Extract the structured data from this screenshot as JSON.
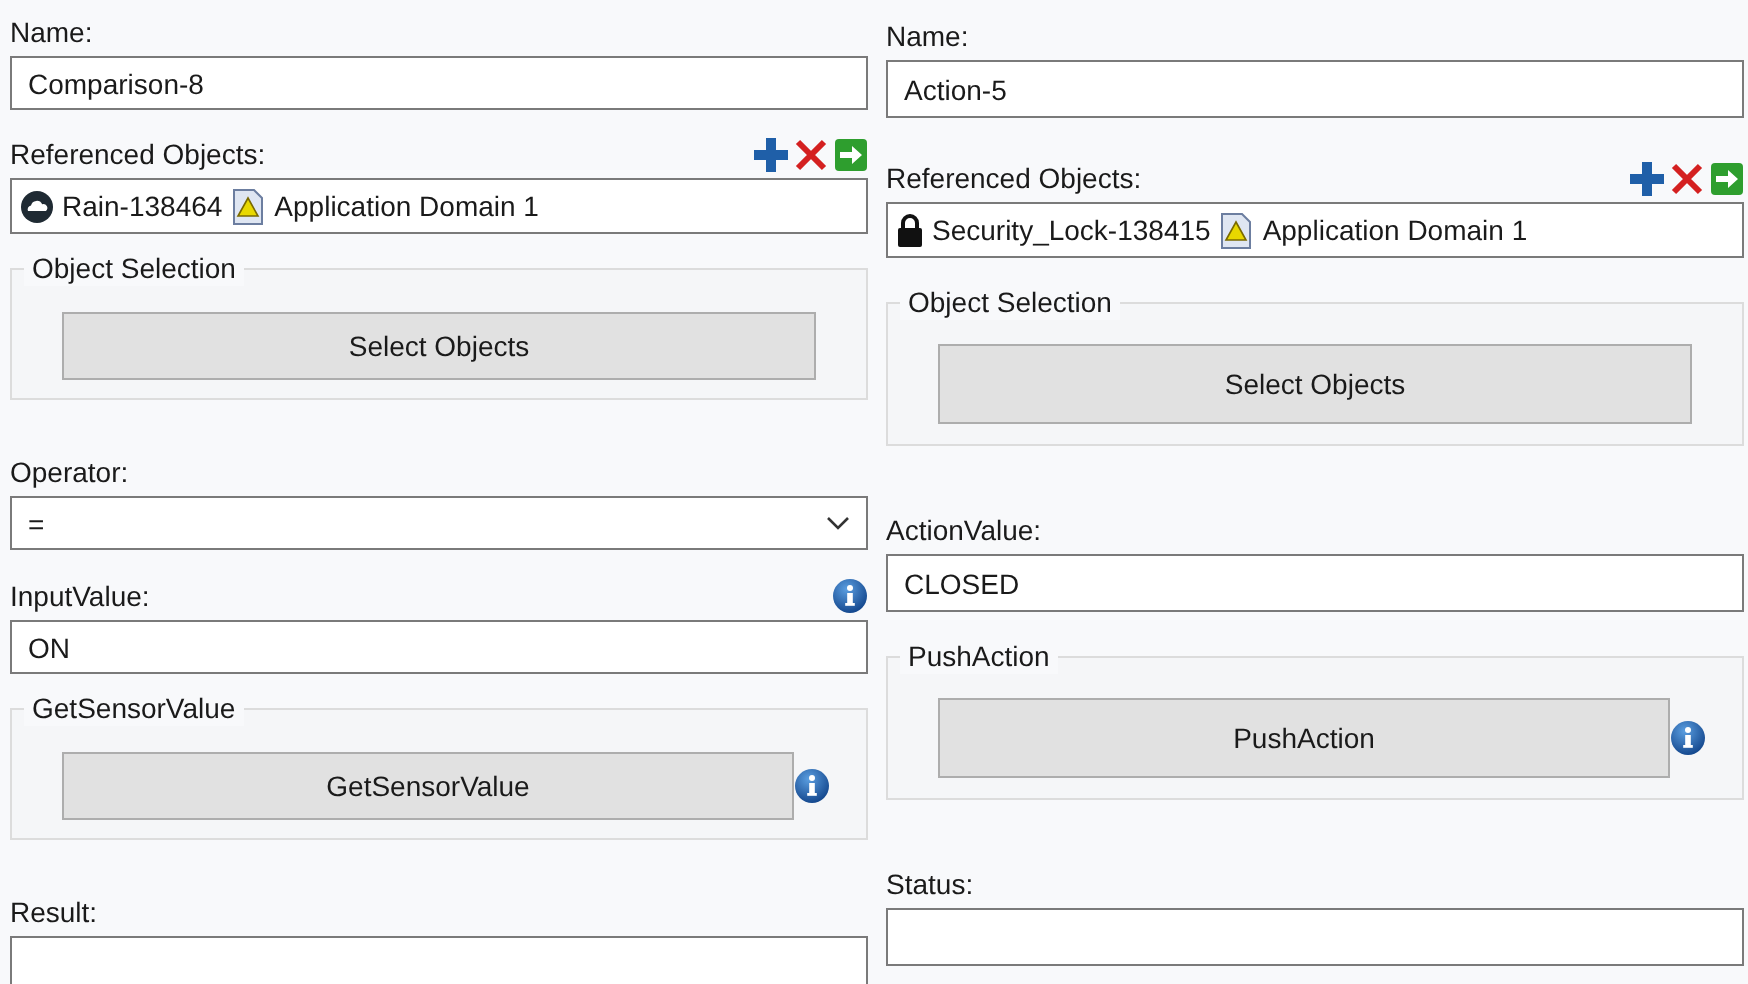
{
  "panels": [
    {
      "items": [
        {
          "kind": "field",
          "label": "Name:",
          "value": "Comparison-8",
          "info": false
        },
        {
          "kind": "refs",
          "label": "Referenced Objects:",
          "objects": [
            {
              "name": "Rain-138464",
              "domain": "Application Domain 1"
            }
          ]
        },
        {
          "kind": "group",
          "legend": "Object Selection",
          "button": "Select Objects",
          "info": false
        },
        {
          "kind": "combo",
          "label": "Operator:",
          "value": "="
        },
        {
          "kind": "field",
          "label": "InputValue:",
          "value": "ON",
          "info": true
        },
        {
          "kind": "group",
          "legend": "GetSensorValue",
          "button": "GetSensorValue",
          "info": true
        },
        {
          "kind": "field",
          "label": "Result:",
          "info": false
        }
      ]
    },
    {
      "items": [
        {
          "kind": "field",
          "label": "Name:",
          "value": "Action-5",
          "info": false
        },
        {
          "kind": "refs",
          "label": "Referenced Objects:",
          "objects": [
            {
              "name": "Security_Lock-138415",
              "domain": "Application Domain 1"
            }
          ]
        },
        {
          "kind": "group",
          "legend": "Object Selection",
          "button": "Select Objects",
          "info": false
        },
        {
          "kind": "field",
          "label": "ActionValue:",
          "value": "CLOSED",
          "info": false
        },
        {
          "kind": "group",
          "legend": "PushAction",
          "button": "PushAction",
          "info": true
        },
        {
          "kind": "field",
          "label": "Status:",
          "info": false
        }
      ]
    }
  ]
}
